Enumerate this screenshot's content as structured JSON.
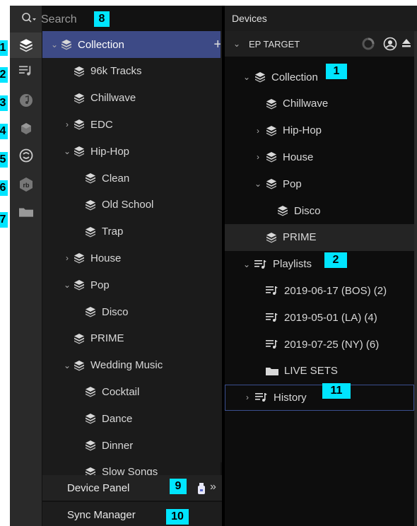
{
  "search": {
    "placeholder": "Search"
  },
  "rail": {
    "items": [
      {
        "name": "collection-rail-icon",
        "callout": "1"
      },
      {
        "name": "playlists-rail-icon",
        "callout": "2"
      },
      {
        "name": "music-rail-icon",
        "callout": "3"
      },
      {
        "name": "engine-library-rail-icon",
        "callout": "4"
      },
      {
        "name": "serato-rail-icon",
        "callout": "5"
      },
      {
        "name": "rekordbox-rail-icon",
        "callout": "6"
      },
      {
        "name": "folder-rail-icon",
        "callout": "7"
      }
    ]
  },
  "browser": {
    "items": [
      {
        "label": "Collection",
        "indent": 0,
        "chevron": "open",
        "selected": true,
        "plus": "+"
      },
      {
        "label": "96k Tracks",
        "indent": 1,
        "chevron": "none"
      },
      {
        "label": "Chillwave",
        "indent": 1,
        "chevron": "none"
      },
      {
        "label": "EDC",
        "indent": 1,
        "chevron": "closed"
      },
      {
        "label": "Hip-Hop",
        "indent": 1,
        "chevron": "open"
      },
      {
        "label": "Clean",
        "indent": 2,
        "chevron": "none"
      },
      {
        "label": "Old School",
        "indent": 2,
        "chevron": "none"
      },
      {
        "label": "Trap",
        "indent": 2,
        "chevron": "none"
      },
      {
        "label": "House",
        "indent": 1,
        "chevron": "closed"
      },
      {
        "label": "Pop",
        "indent": 1,
        "chevron": "open"
      },
      {
        "label": "Disco",
        "indent": 2,
        "chevron": "none"
      },
      {
        "label": "PRIME",
        "indent": 1,
        "chevron": "none"
      },
      {
        "label": "Wedding Music",
        "indent": 1,
        "chevron": "open"
      },
      {
        "label": "Cocktail",
        "indent": 2,
        "chevron": "none"
      },
      {
        "label": "Dance",
        "indent": 2,
        "chevron": "none"
      },
      {
        "label": "Dinner",
        "indent": 2,
        "chevron": "none"
      },
      {
        "label": "Slow Songs",
        "indent": 2,
        "chevron": "none"
      }
    ]
  },
  "bottom": {
    "device_panel": "Device Panel",
    "sync_manager": "Sync Manager",
    "expand_glyph": "»"
  },
  "devices": {
    "header": "Devices",
    "target": "EP TARGET",
    "items": [
      {
        "label": "Collection",
        "indent": 1,
        "chevron": "open",
        "icon": "crate",
        "plus": "+"
      },
      {
        "label": "Chillwave",
        "indent": 2,
        "chevron": "none",
        "icon": "crate"
      },
      {
        "label": "Hip-Hop",
        "indent": 2,
        "chevron": "closed",
        "icon": "crate"
      },
      {
        "label": "House",
        "indent": 2,
        "chevron": "closed",
        "icon": "crate"
      },
      {
        "label": "Pop",
        "indent": 2,
        "chevron": "open",
        "icon": "crate"
      },
      {
        "label": "Disco",
        "indent": 3,
        "chevron": "none",
        "icon": "crate"
      },
      {
        "label": "PRIME",
        "indent": 2,
        "chevron": "none",
        "icon": "crate",
        "plus": "+",
        "hl": true
      },
      {
        "label": "Playlists",
        "indent": 1,
        "chevron": "open",
        "icon": "playlist",
        "plus": "+"
      },
      {
        "label": "2019-06-17 (BOS) (2)",
        "indent": 2,
        "chevron": "none",
        "icon": "playlist"
      },
      {
        "label": "2019-05-01 (LA) (4)",
        "indent": 2,
        "chevron": "none",
        "icon": "playlist"
      },
      {
        "label": "2019-07-25 (NY) (6)",
        "indent": 2,
        "chevron": "none",
        "icon": "playlist"
      },
      {
        "label": "LIVE SETS",
        "indent": 2,
        "chevron": "none",
        "icon": "folder"
      },
      {
        "label": "History",
        "indent": 1,
        "chevron": "closed",
        "icon": "playlist",
        "hist": true
      }
    ]
  },
  "callouts": {
    "search": "8",
    "device_panel": "9",
    "sync_manager": "10",
    "dev_collection": "1",
    "dev_playlists": "2",
    "dev_history": "11"
  },
  "colors": {
    "accent": "#3d4a86",
    "callout": "#00e5ff",
    "history_border": "#3b4f8f"
  }
}
